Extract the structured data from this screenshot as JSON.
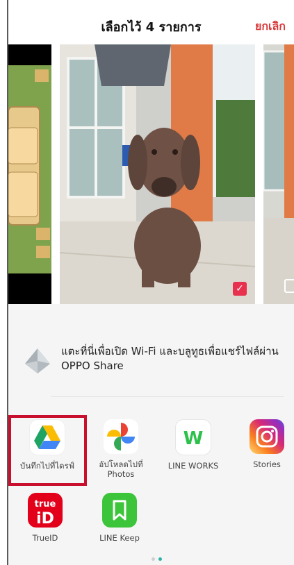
{
  "header": {
    "title": "เลือกไว้ 4 รายการ",
    "cancel_label": "ยกเลิก"
  },
  "gallery": {
    "photos": [
      {
        "description_icon": "game-screenshot"
      },
      {
        "description_icon": "dog-photo",
        "selected": true
      },
      {
        "description_icon": "house-photo",
        "selected": false
      }
    ]
  },
  "share": {
    "oppo_text": "แตะที่นี่เพื่อเปิด Wi-Fi และบลูทูธเพื่อแชร์ไฟล์ผ่าน OPPO Share",
    "apps": [
      {
        "label": "บันทึกไปที่ไดรฟ์",
        "icon": "google-drive-icon"
      },
      {
        "label": "อัปโหลดไปที่ Photos",
        "icon": "google-photos-icon"
      },
      {
        "label": "LINE WORKS",
        "icon": "line-works-icon"
      },
      {
        "label": "Stories",
        "icon": "instagram-icon"
      },
      {
        "label": "TrueID",
        "icon": "trueid-icon"
      },
      {
        "label": "LINE Keep",
        "icon": "line-keep-icon"
      }
    ]
  },
  "colors": {
    "accent": "#d93a3a",
    "highlight_border": "#c8102e",
    "checkbox": "#e8314e"
  },
  "pager": {
    "pages": 2,
    "active": 2
  }
}
